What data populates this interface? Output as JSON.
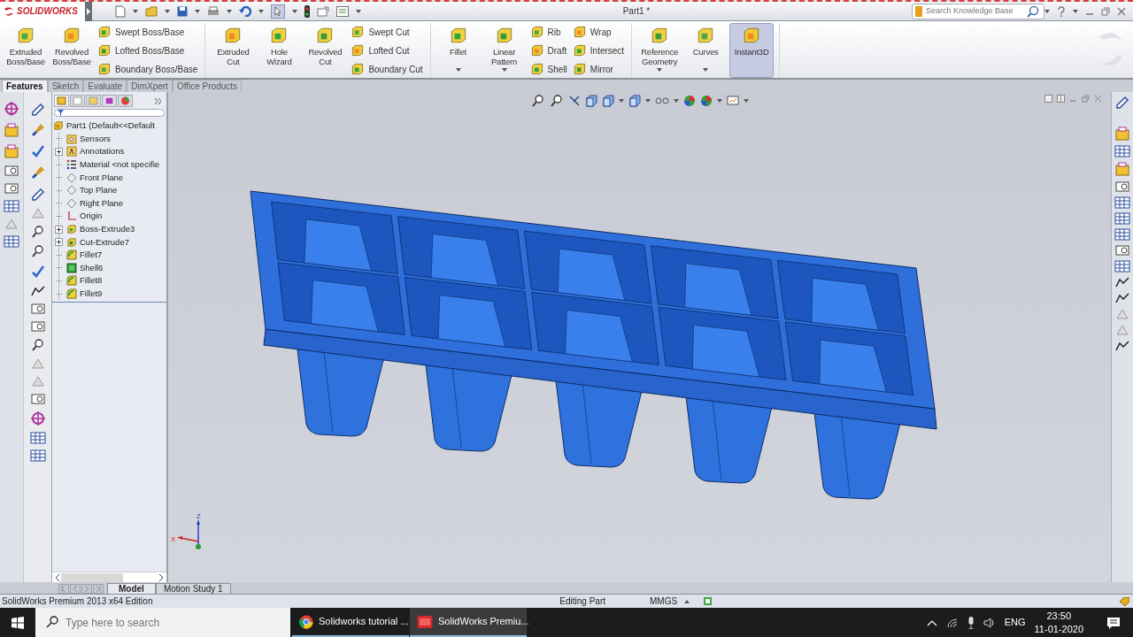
{
  "title_bar": {
    "logo": "SOLIDWORKS",
    "title": "Part1 *",
    "search": {
      "placeholder": "Search Knowledge Base"
    }
  },
  "ribbon": {
    "groups": [
      {
        "columns": [
          {
            "kind": "large",
            "label": "Extruded Boss/Base",
            "dropdown": false,
            "on": false
          },
          {
            "kind": "large",
            "label": "Revolved Boss/Base",
            "dropdown": false,
            "on": false
          },
          {
            "kind": "stack",
            "items": [
              "Swept Boss/Base",
              "Lofted Boss/Base",
              "Boundary Boss/Base"
            ]
          }
        ]
      },
      {
        "columns": [
          {
            "kind": "large",
            "label": "Extruded Cut",
            "dropdown": false,
            "on": false
          },
          {
            "kind": "large",
            "label": "Hole Wizard",
            "dropdown": false,
            "on": false
          },
          {
            "kind": "large",
            "label": "Revolved Cut",
            "dropdown": false,
            "on": false
          },
          {
            "kind": "stack",
            "items": [
              "Swept Cut",
              "Lofted Cut",
              "Boundary Cut"
            ]
          }
        ]
      },
      {
        "columns": [
          {
            "kind": "large",
            "label": "Fillet",
            "dropdown": true,
            "on": false
          },
          {
            "kind": "large",
            "label": "Linear Pattern",
            "dropdown": true,
            "on": false
          },
          {
            "kind": "stack",
            "items": [
              "Rib",
              "Draft",
              "Shell"
            ]
          },
          {
            "kind": "stack",
            "items": [
              "Wrap",
              "Intersect",
              "Mirror"
            ]
          }
        ]
      },
      {
        "columns": [
          {
            "kind": "large",
            "label": "Reference Geometry",
            "dropdown": true,
            "on": false
          },
          {
            "kind": "large",
            "label": "Curves",
            "dropdown": true,
            "on": false
          },
          {
            "kind": "large",
            "label": "Instant3D",
            "dropdown": false,
            "on": true
          }
        ]
      }
    ]
  },
  "tabs": [
    {
      "label": "Features",
      "selected": true
    },
    {
      "label": "Sketch",
      "selected": false
    },
    {
      "label": "Evaluate",
      "selected": false
    },
    {
      "label": "DimXpert",
      "selected": false
    },
    {
      "label": "Office Products",
      "selected": false
    }
  ],
  "feature_tree": {
    "panel_tabs": [
      {
        "selected": true
      },
      {
        "selected": false
      },
      {
        "selected": false
      },
      {
        "selected": false
      },
      {
        "selected": false
      }
    ],
    "root": {
      "label": "Part1  (Default<<Default",
      "children": [
        {
          "label": "Sensors",
          "kind": "sensor",
          "expandable": false
        },
        {
          "label": "Annotations",
          "kind": "annotation",
          "expandable": true
        },
        {
          "label": "Material <not specifie",
          "kind": "material",
          "expandable": false
        },
        {
          "label": "Front Plane",
          "kind": "plane",
          "expandable": false
        },
        {
          "label": "Top Plane",
          "kind": "plane",
          "expandable": false
        },
        {
          "label": "Right Plane",
          "kind": "plane",
          "expandable": false
        },
        {
          "label": "Origin",
          "kind": "origin",
          "expandable": false
        },
        {
          "label": "Boss-Extrude3",
          "kind": "extrude",
          "expandable": true
        },
        {
          "label": "Cut-Extrude7",
          "kind": "cut",
          "expandable": true
        },
        {
          "label": "Fillet7",
          "kind": "fillet",
          "expandable": false
        },
        {
          "label": "Shell6",
          "kind": "shell",
          "expandable": false
        },
        {
          "label": "Fillet8",
          "kind": "fillet",
          "expandable": false
        },
        {
          "label": "Fillet9",
          "kind": "fillet",
          "expandable": false
        }
      ]
    }
  },
  "viewport": {
    "triad": [
      "Z",
      "X"
    ]
  },
  "model_tabs": [
    {
      "label": "Model",
      "selected": true
    },
    {
      "label": "Motion Study 1",
      "selected": false
    }
  ],
  "status_bar": {
    "product": "SolidWorks Premium 2013 x64 Edition",
    "mode": "Editing Part",
    "units": "MMGS"
  },
  "taskbar": {
    "search": {
      "placeholder": "Type here to search"
    },
    "apps": [
      {
        "label": "Solidworks tutorial ...",
        "kind": "browser",
        "active": false
      },
      {
        "label": "SolidWorks Premiu...",
        "kind": "cad",
        "active": true
      }
    ],
    "language": "ENG",
    "time": "23:50",
    "date": "11-01-2020"
  }
}
